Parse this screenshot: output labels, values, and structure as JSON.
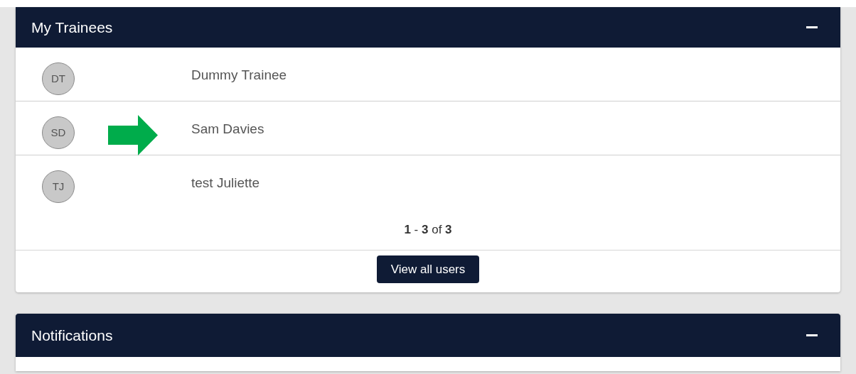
{
  "trainees_panel": {
    "title": "My Trainees",
    "expanded": true,
    "trainees": [
      {
        "initials": "DT",
        "name": "Dummy Trainee",
        "marked": false
      },
      {
        "initials": "SD",
        "name": "Sam Davies",
        "marked": true
      },
      {
        "initials": "TJ",
        "name": "test Juliette",
        "marked": false
      }
    ],
    "pagination": "**1** - **3** of **3**",
    "button": "View all users"
  },
  "notifications_panel": {
    "title": "Notifications",
    "expanded": true
  }
}
